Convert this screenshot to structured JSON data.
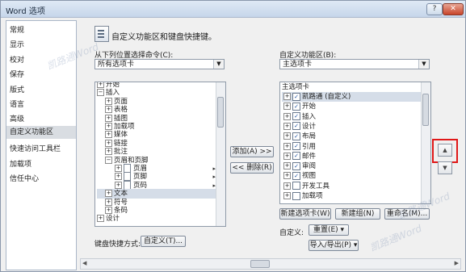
{
  "window": {
    "title": "Word 选项",
    "help_glyph": "?",
    "close_glyph": "✕"
  },
  "sidebar": {
    "items": [
      {
        "label": "常规"
      },
      {
        "label": "显示"
      },
      {
        "label": "校对"
      },
      {
        "label": "保存"
      },
      {
        "label": "版式"
      },
      {
        "label": "语言"
      },
      {
        "label": "高级"
      },
      {
        "label": "自定义功能区"
      },
      {
        "label": "快速访问工具栏"
      },
      {
        "label": "加载项"
      },
      {
        "label": "信任中心"
      }
    ],
    "active": "自定义功能区"
  },
  "header": {
    "title": "自定义功能区和键盘快捷键。"
  },
  "left": {
    "label": "从下列位置选择命令(C):",
    "combo_value": "所有选项卡",
    "tree": [
      {
        "label": "开始",
        "level": 0,
        "exp": "⊞"
      },
      {
        "label": "插入",
        "level": 0,
        "exp": "⊟"
      },
      {
        "label": "页面",
        "level": 1,
        "exp": "⊞"
      },
      {
        "label": "表格",
        "level": 1,
        "exp": "⊞"
      },
      {
        "label": "插图",
        "level": 1,
        "exp": "⊞"
      },
      {
        "label": "加载项",
        "level": 1,
        "exp": "⊞"
      },
      {
        "label": "媒体",
        "level": 1,
        "exp": "⊞"
      },
      {
        "label": "链接",
        "level": 1,
        "exp": "⊞"
      },
      {
        "label": "批注",
        "level": 1,
        "exp": "⊞"
      },
      {
        "label": "页眉和页脚",
        "level": 1,
        "exp": "⊟"
      },
      {
        "label": "页眉",
        "level": 2,
        "exp": "⊞"
      },
      {
        "label": "页脚",
        "level": 2,
        "exp": "⊞"
      },
      {
        "label": "页码",
        "level": 2,
        "exp": "⊞"
      },
      {
        "label": "文本",
        "level": 1,
        "exp": "⊞"
      },
      {
        "label": "符号",
        "level": 1,
        "exp": "⊞"
      },
      {
        "label": "条码",
        "level": 1,
        "exp": "⊞"
      },
      {
        "label": "设计",
        "level": 0,
        "exp": "⊞"
      }
    ]
  },
  "middle": {
    "add_label": "添加(A) >>",
    "remove_label": "<< 删除(R)"
  },
  "right": {
    "label": "自定义功能区(B):",
    "combo_value": "主选项卡",
    "header": "主选项卡",
    "tree": [
      {
        "label": "凯路通 (自定义)",
        "checked": true
      },
      {
        "label": "开始",
        "checked": true
      },
      {
        "label": "插入",
        "checked": true
      },
      {
        "label": "设计",
        "checked": true
      },
      {
        "label": "布局",
        "checked": true
      },
      {
        "label": "引用",
        "checked": true
      },
      {
        "label": "邮件",
        "checked": true
      },
      {
        "label": "审阅",
        "checked": true
      },
      {
        "label": "视图",
        "checked": true
      },
      {
        "label": "开发工具",
        "checked": false
      },
      {
        "label": "加载项",
        "checked": false
      }
    ],
    "new_tab_label": "新建选项卡(W)",
    "new_group_label": "新建组(N)",
    "rename_label": "重命名(M)...",
    "custom_label": "自定义:",
    "reset_value": "重置(E) ▾",
    "import_export_value": "导入/导出(P) ▾"
  },
  "shortcuts": {
    "label": "键盘快捷方式:",
    "button_label": "自定义(T)..."
  },
  "side_arrows": {
    "up": "▲",
    "down": "▼"
  },
  "watermarks": [
    "凯路通Word",
    "凯路通Word",
    "凯路通Word"
  ]
}
